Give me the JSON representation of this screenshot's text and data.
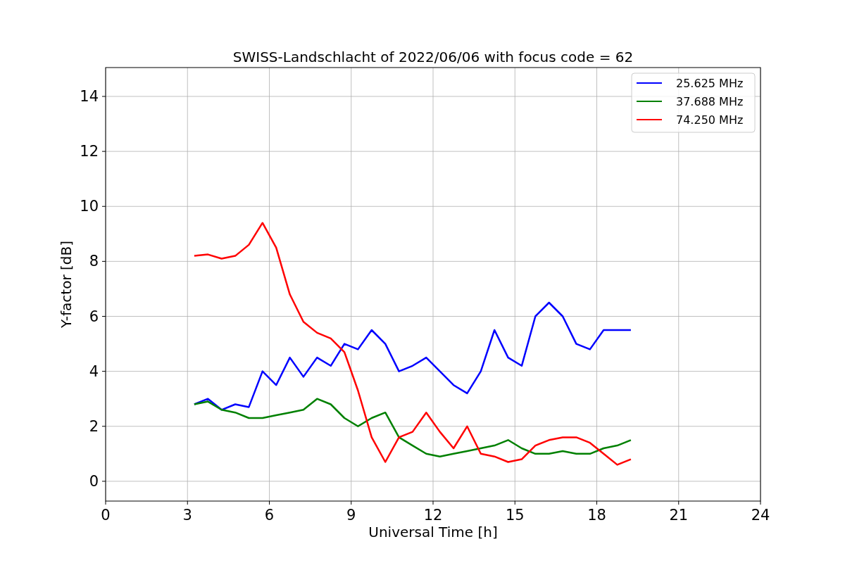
{
  "chart_data": {
    "type": "line",
    "title": "SWISS-Landschlacht of 2022/06/06 with focus code = 62",
    "xlabel": "Universal Time [h]",
    "ylabel": "Y-factor [dB]",
    "x": [
      3.25,
      3.75,
      4.25,
      4.75,
      5.25,
      5.75,
      6.25,
      6.75,
      7.25,
      7.75,
      8.25,
      8.75,
      9.25,
      9.75,
      10.25,
      10.75,
      11.25,
      11.75,
      12.25,
      12.75,
      13.25,
      13.75,
      14.25,
      14.75,
      15.25,
      15.75,
      16.25,
      16.75,
      17.25,
      17.75,
      18.25,
      18.75,
      19.25
    ],
    "series": [
      {
        "name": "25.625 MHz",
        "color": "#0000ff",
        "values": [
          2.8,
          3.0,
          2.6,
          2.8,
          2.7,
          4.0,
          3.5,
          4.5,
          3.8,
          4.5,
          4.2,
          5.0,
          4.8,
          5.5,
          5.0,
          4.0,
          4.2,
          4.5,
          4.0,
          3.5,
          3.2,
          4.0,
          5.5,
          4.5,
          4.2,
          6.0,
          6.5,
          6.0,
          5.0,
          4.8,
          5.5,
          5.5,
          5.5
        ]
      },
      {
        "name": "37.688 MHz",
        "color": "#008000",
        "values": [
          2.8,
          2.9,
          2.6,
          2.5,
          2.3,
          2.3,
          2.4,
          2.5,
          2.6,
          3.0,
          2.8,
          2.3,
          2.0,
          2.3,
          2.5,
          1.6,
          1.3,
          1.0,
          0.9,
          1.0,
          1.1,
          1.2,
          1.3,
          1.5,
          1.2,
          1.0,
          1.0,
          1.1,
          1.0,
          1.0,
          1.2,
          1.3,
          1.5
        ]
      },
      {
        "name": "74.250 MHz",
        "color": "#ff0000",
        "values": [
          8.2,
          8.25,
          8.1,
          8.2,
          8.6,
          9.4,
          8.5,
          6.8,
          5.8,
          5.4,
          5.2,
          4.7,
          3.3,
          1.6,
          0.7,
          1.6,
          1.8,
          2.5,
          1.8,
          1.2,
          2.0,
          1.0,
          0.9,
          0.7,
          0.8,
          1.3,
          1.5,
          1.6,
          1.6,
          1.4,
          1.0,
          0.6,
          0.8
        ]
      }
    ],
    "xlim": [
      0,
      24
    ],
    "ylim": [
      -0.72,
      15.05
    ],
    "xticks": [
      0,
      3,
      6,
      9,
      12,
      15,
      18,
      21,
      24
    ],
    "yticks": [
      0,
      2,
      4,
      6,
      8,
      10,
      12,
      14
    ],
    "grid": true,
    "legend": true
  }
}
